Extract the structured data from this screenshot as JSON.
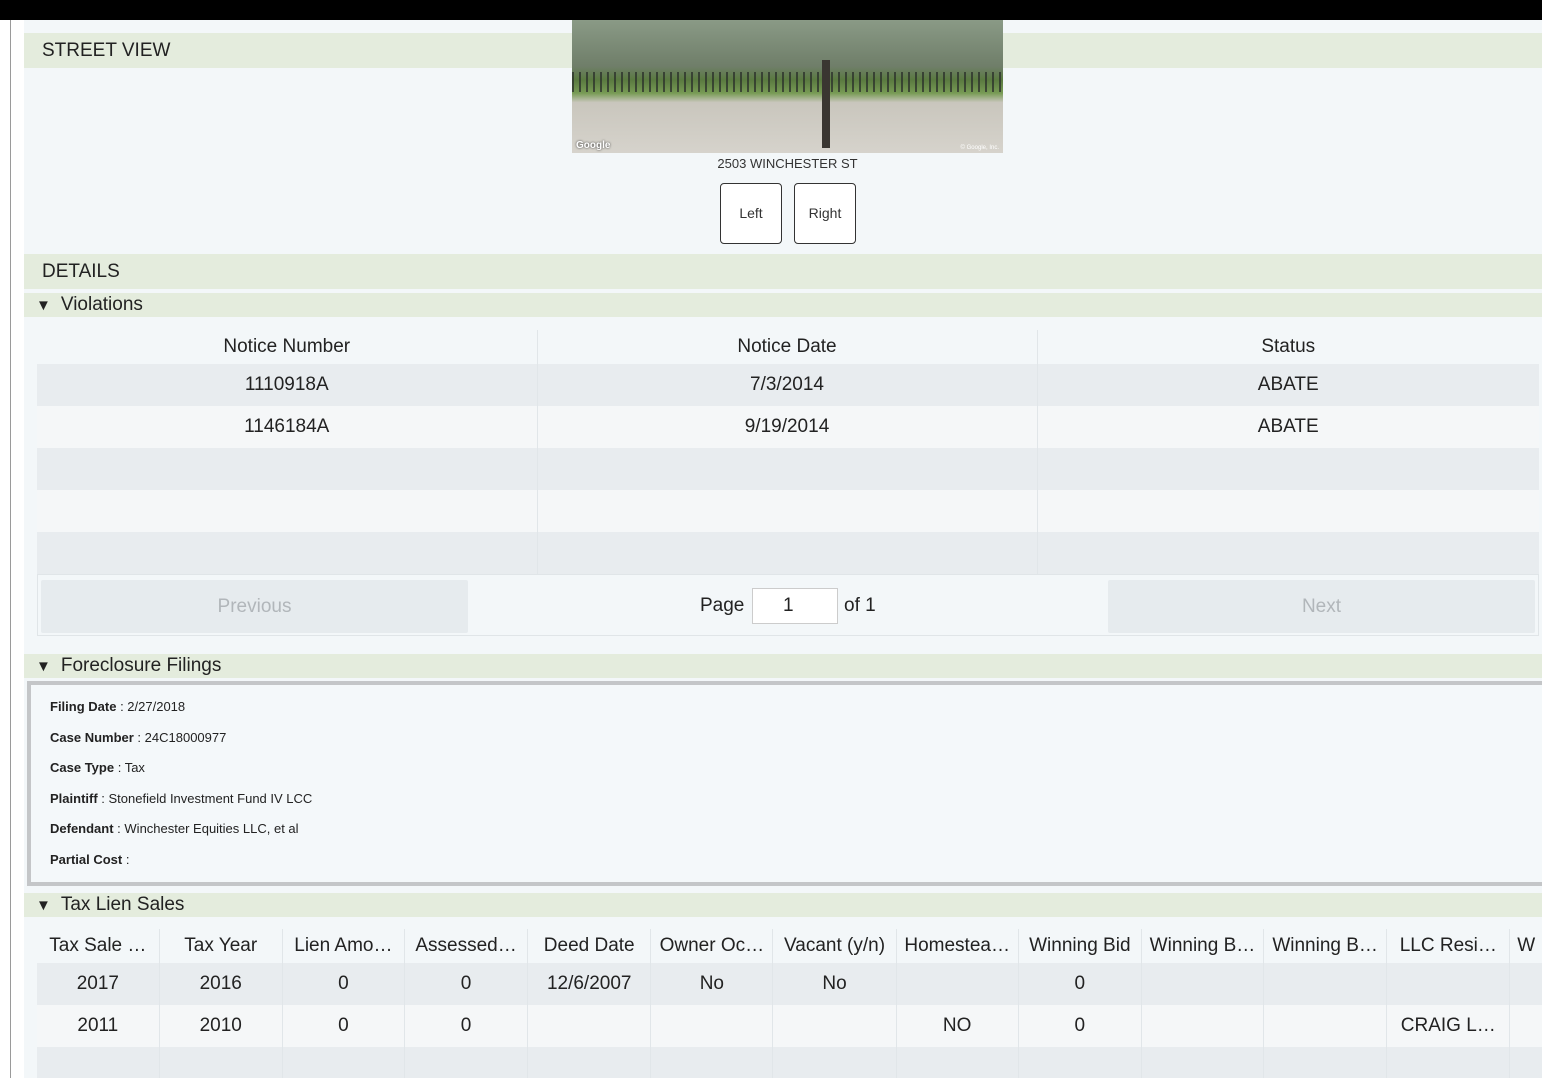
{
  "street_view": {
    "header": "STREET VIEW",
    "photo_watermark": "Google",
    "photo_copyright": "© Google, Inc.",
    "address": "2503 WINCHESTER ST",
    "left_button": "Left",
    "right_button": "Right"
  },
  "details": {
    "header": "DETAILS"
  },
  "violations": {
    "title": "Violations",
    "columns": [
      "Notice Number",
      "Notice Date",
      "Status"
    ],
    "rows": [
      [
        "1110918A",
        "7/3/2014",
        "ABATE"
      ],
      [
        "1146184A",
        "9/19/2014",
        "ABATE"
      ]
    ],
    "pager": {
      "previous": "Previous",
      "page_label": "Page",
      "page_value": "1",
      "of_label": "of 1",
      "next": "Next"
    }
  },
  "foreclosure": {
    "title": "Foreclosure Filings",
    "fields": [
      {
        "label": "Filing Date",
        "value": "2/27/2018"
      },
      {
        "label": "Case Number",
        "value": "24C18000977"
      },
      {
        "label": "Case Type",
        "value": "Tax"
      },
      {
        "label": "Plaintiff",
        "value": "Stonefield Investment Fund IV LCC"
      },
      {
        "label": "Defendant",
        "value": "Winchester Equities LLC, et al"
      },
      {
        "label": "Partial Cost",
        "value": ""
      }
    ]
  },
  "tax_lien": {
    "title": "Tax Lien Sales",
    "columns": [
      "Tax Sale …",
      "Tax Year",
      "Lien Amo…",
      "Assessed…",
      "Deed Date",
      "Owner Oc…",
      "Vacant (y/n)",
      "Homestea…",
      "Winning Bid",
      "Winning B…",
      "Winning B…",
      "LLC Resi…",
      "W"
    ],
    "rows": [
      [
        "2017",
        "2016",
        "0",
        "0",
        "12/6/2007",
        "No",
        "No",
        "",
        "0",
        "",
        "",
        "",
        ""
      ],
      [
        "2011",
        "2010",
        "0",
        "0",
        "",
        "",
        "",
        "NO",
        "0",
        "",
        "",
        "CRAIG L…",
        ""
      ]
    ]
  }
}
